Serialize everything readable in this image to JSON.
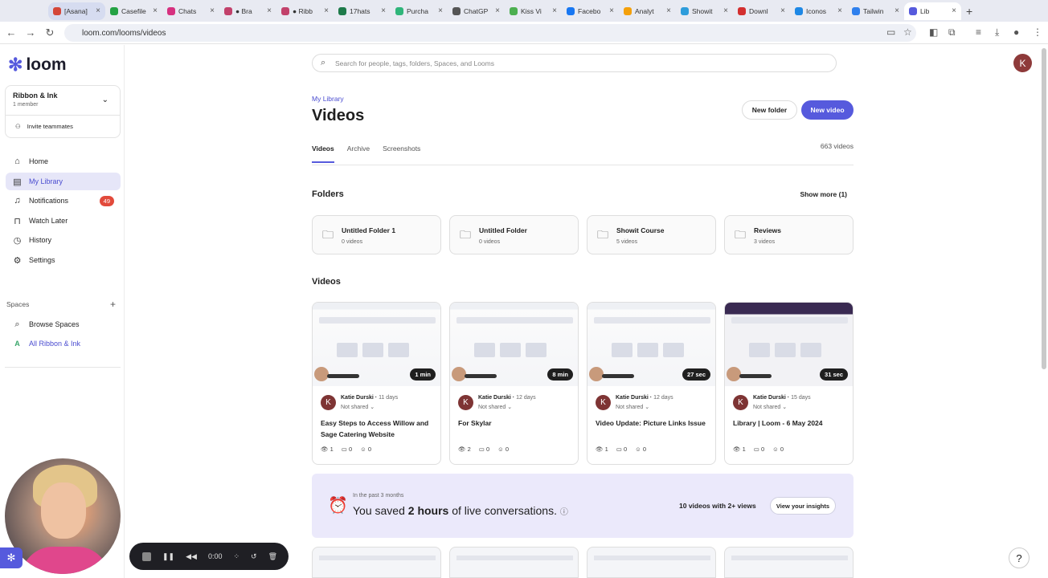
{
  "browser": {
    "tabs": [
      {
        "label": "[Asana]",
        "color": "#d44638"
      },
      {
        "label": "Casefile",
        "color": "#25a244"
      },
      {
        "label": "Chats",
        "color": "#d6317f"
      },
      {
        "label": "● Bra",
        "color": "#c2416b"
      },
      {
        "label": "● Ribb",
        "color": "#c2416b"
      },
      {
        "label": "17hats",
        "color": "#1e7a4a"
      },
      {
        "label": "Purcha",
        "color": "#2fb57a"
      },
      {
        "label": "ChatGP",
        "color": "#555555"
      },
      {
        "label": "Kiss Vi",
        "color": "#4caf50"
      },
      {
        "label": "Facebo",
        "color": "#1877f2"
      },
      {
        "label": "Analyt",
        "color": "#f4a00b"
      },
      {
        "label": "Showit",
        "color": "#2d9cdb"
      },
      {
        "label": "Downl",
        "color": "#d32f2f"
      },
      {
        "label": "Iconos",
        "color": "#1e88e5"
      },
      {
        "label": "Tailwin",
        "color": "#2f80ed"
      },
      {
        "label": "Lib",
        "color": "#565ADD"
      }
    ],
    "new_tab": "+",
    "url": "loom.com/looms/videos"
  },
  "sidebar": {
    "logo": "loom",
    "workspace_name": "Ribbon & Ink",
    "workspace_members": "1 member",
    "invite": "Invite teammates",
    "items": [
      {
        "label": "Home",
        "icon": "home-icon",
        "glyph": "⌂"
      },
      {
        "label": "My Library",
        "icon": "library-icon",
        "glyph": "▤"
      },
      {
        "label": "Notifications",
        "icon": "bell-icon",
        "glyph": "♫",
        "badge": "49"
      },
      {
        "label": "Watch Later",
        "icon": "bookmark-icon",
        "glyph": "⊓"
      },
      {
        "label": "History",
        "icon": "clock-icon",
        "glyph": "◷"
      },
      {
        "label": "Settings",
        "icon": "gear-icon",
        "glyph": "⚙"
      }
    ],
    "spaces_label": "Spaces",
    "browse_spaces": "Browse Spaces",
    "all_space": "All Ribbon & Ink",
    "all_space_letter": "A"
  },
  "search": {
    "placeholder": "Search for people, tags, folders, Spaces, and Looms"
  },
  "user_initial": "K",
  "page": {
    "breadcrumb": "My Library",
    "title": "Videos",
    "new_folder": "New folder",
    "new_video": "New video",
    "tabs": [
      "Videos",
      "Archive",
      "Screenshots"
    ],
    "video_count": "663 videos",
    "folders_heading": "Folders",
    "show_more": "Show more (1)",
    "videos_heading": "Videos"
  },
  "folders": [
    {
      "name": "Untitled Folder 1",
      "count": "0 videos"
    },
    {
      "name": "Untitled Folder",
      "count": "0 videos"
    },
    {
      "name": "Showit Course",
      "count": "5 videos"
    },
    {
      "name": "Reviews",
      "count": "3 videos"
    }
  ],
  "videos": [
    {
      "duration": "1 min",
      "author": "Katie Durski",
      "age": "11 days",
      "share": "Not shared",
      "title": "Easy Steps to Access Willow and Sage Catering Website",
      "views": "1",
      "comments": "0",
      "reactions": "0"
    },
    {
      "duration": "8 min",
      "author": "Katie Durski",
      "age": "12 days",
      "share": "Not shared",
      "title": "For Skylar",
      "views": "2",
      "comments": "0",
      "reactions": "0"
    },
    {
      "duration": "27 sec",
      "author": "Katie Durski",
      "age": "12 days",
      "share": "Not shared",
      "title": "Video Update: Picture Links Issue",
      "views": "1",
      "comments": "0",
      "reactions": "0"
    },
    {
      "duration": "31 sec",
      "author": "Katie Durski",
      "age": "15 days",
      "share": "Not shared",
      "title": "Library | Loom - 6 May 2024",
      "views": "1",
      "comments": "0",
      "reactions": "0"
    }
  ],
  "insight": {
    "period": "In the past 3 months",
    "saved_prefix": "You saved",
    "saved_amount": "2 hours",
    "saved_suffix": "of live conversations.",
    "views_stat": "10 videos with 2+ views",
    "cta": "View your insights"
  },
  "recorder": {
    "time": "0:00"
  },
  "help": "?",
  "colors": {
    "accent": "#565ADD",
    "badge": "#e24a3b"
  }
}
